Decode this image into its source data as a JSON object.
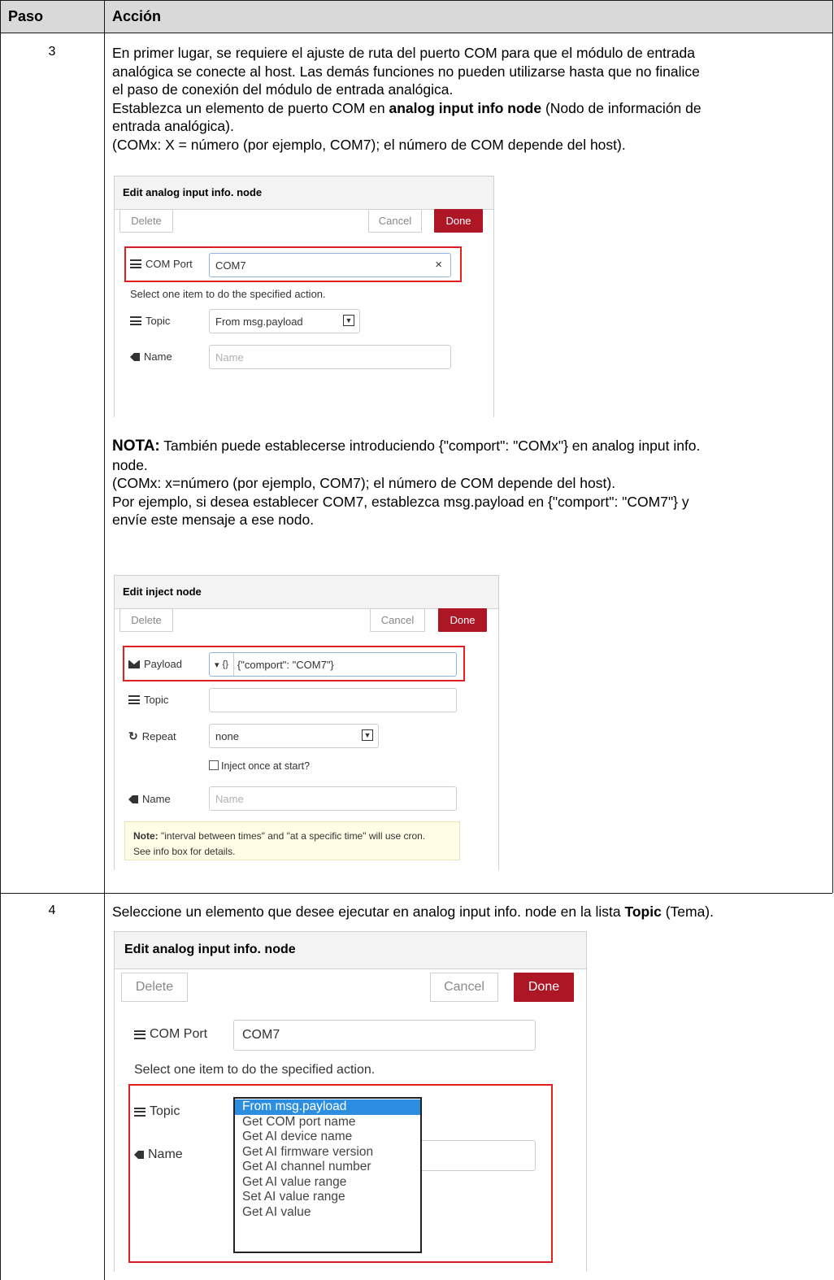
{
  "table": {
    "headers": {
      "step": "Paso",
      "action": "Acción"
    }
  },
  "rows": [
    {
      "step": "3",
      "lines": [
        "En primer lugar, se requiere el ajuste de ruta del puerto COM para que el módulo de entrada",
        "analógica se conecte al host. Las demás funciones no pueden utilizarse hasta que no finalice",
        "el paso de conexión del módulo de entrada analógica."
      ],
      "set_line_pre": "Establezca un elemento de puerto COM en ",
      "set_line_bold": "analog input info node",
      "set_line_post": " (Nodo de información de",
      "set_line_cont": "entrada analógica).",
      "comx_line": "(COMx: X = número (por ejemplo, COM7); el número de COM depende del host).",
      "note_label": "NOTA:",
      "note_line1": " También puede establecerse introduciendo {\"comport\": \"COMx\"} en analog input info.",
      "note_line2": "node.",
      "note_line3": "(COMx: x=número (por ejemplo, COM7); el número de COM depende del host).",
      "note_line4": "Por ejemplo, si desea establecer COM7, establezca msg.payload en {\"comport\": \"COM7\"} y",
      "note_line5": "envíe este mensaje a ese nodo."
    },
    {
      "step": "4",
      "text_pre": "Seleccione un elemento que desee ejecutar en analog input info. node en la lista ",
      "text_bold": "Topic",
      "text_post": " (Tema)."
    }
  ],
  "dialog1": {
    "title": "Edit analog input info. node",
    "delete": "Delete",
    "cancel": "Cancel",
    "done": "Done",
    "com_label": "COM Port",
    "com_value": "COM7",
    "clear": "×",
    "hint": "Select one item to do the specified action.",
    "topic_label": "Topic",
    "topic_value": "From msg.payload",
    "name_label": "Name",
    "name_placeholder": "Name"
  },
  "dialog2": {
    "title": "Edit inject node",
    "delete": "Delete",
    "cancel": "Cancel",
    "done": "Done",
    "payload_label": "Payload",
    "payload_type": "{}",
    "payload_value": "{\"comport\": \"COM7\"}",
    "topic_label": "Topic",
    "repeat_label": "Repeat",
    "repeat_value": "none",
    "inject_once": "Inject once at start?",
    "name_label": "Name",
    "name_placeholder": "Name",
    "note_bold": "Note:",
    "note_text": " \"interval between times\" and \"at a specific time\" will use cron.",
    "note_text2": "See info box for details."
  },
  "dialog3": {
    "title": "Edit analog input info. node",
    "delete": "Delete",
    "cancel": "Cancel",
    "done": "Done",
    "com_label": "COM Port",
    "com_value": "COM7",
    "hint": "Select one item to do the specified action.",
    "topic_label": "Topic",
    "name_label": "Name",
    "options": [
      "From msg.payload",
      "Get COM port name",
      "Get AI device name",
      "Get AI firmware version",
      "Get AI channel number",
      "Get AI value range",
      "Set AI value range",
      "Get AI value"
    ]
  },
  "colors": {
    "done": "#ad1625",
    "highlight": "#e02020",
    "selected": "#2b8ee0",
    "header": "#d9d9d9"
  }
}
